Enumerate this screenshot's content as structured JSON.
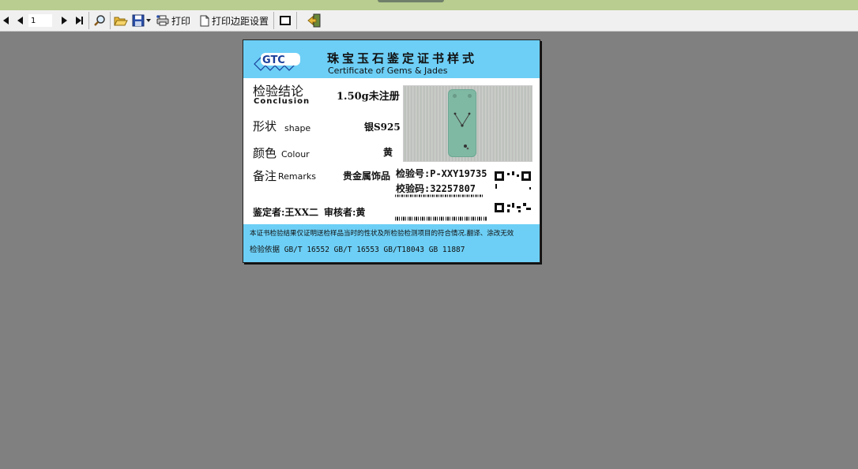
{
  "toolbar": {
    "page_number": "1",
    "print_label": "打印",
    "margin_settings_label": "打印边距设置"
  },
  "certificate": {
    "logo_text": "GTC",
    "title_cn": "珠宝玉石鉴定证书样式",
    "title_en": "Certificate of Gems & Jades",
    "conclusion_label_cn": "检验结论",
    "conclusion_label_en": "Conclusion",
    "conclusion_value": "1.50g未注册",
    "shape_label_cn": "形状",
    "shape_label_en": "shape",
    "shape_value": "银S925",
    "colour_label_cn": "颜色",
    "colour_label_en": "Colour",
    "colour_value": "黄",
    "remarks_label_cn": "备注",
    "remarks_label_en": "Remarks",
    "remarks_value": "贵金属饰品",
    "inspection_no": "检验号:P-XXY19735",
    "check_code": "校验码:32257807",
    "appraiser": "鉴定者:王XX二",
    "reviewer": "审核者:黄",
    "footer_note": "本证书检验结果仅证明送检样品当时的性状及所检验检测项目的符合情况.翻译、涂改无效",
    "footer_standards": "检验依据 GB/T 16552 GB/T 16553 GB/T18043 GB 11887"
  },
  "colors": {
    "header_blue": "#6dcff6",
    "background_gray": "#808080",
    "toolbar_bg": "#f0f0f0"
  }
}
